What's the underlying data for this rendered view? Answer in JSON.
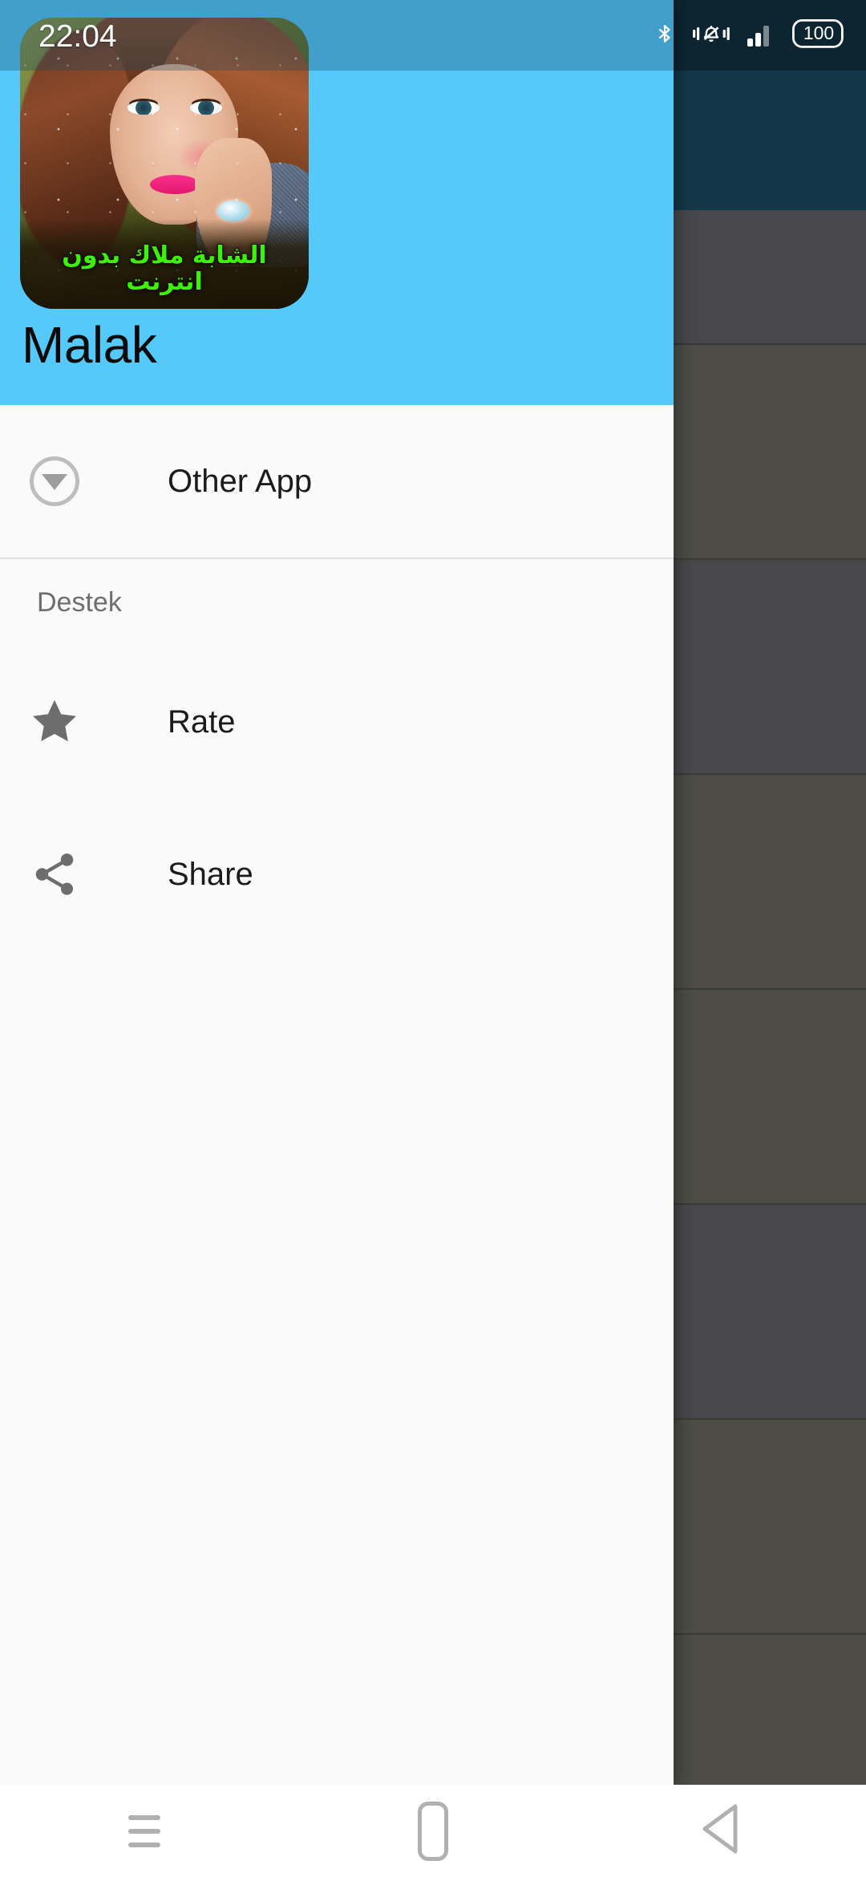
{
  "status_bar": {
    "time": "22:04",
    "icons": [
      {
        "name": "bluetooth-icon",
        "label": "Bluetooth"
      },
      {
        "name": "ringer-vibrate-off-icon",
        "label": "Silent / vibrate"
      },
      {
        "name": "signal-bars-icon",
        "label": "Cellular signal"
      },
      {
        "name": "battery-icon",
        "label": "Battery"
      }
    ],
    "battery_level": "100",
    "left_background": "#3e92b8",
    "right_background": "#5e2424"
  },
  "drawer": {
    "header": {
      "app_title": "Malak",
      "app_icon_caption": "الشابة ملاك بدون انترنت",
      "background_color": "#55c9fa",
      "title_color": "#0a0a0a"
    },
    "items": [
      {
        "id": "other-app",
        "label": "Other App",
        "icon": "arrow-drop-down-circle-icon"
      }
    ],
    "sections": [
      {
        "id": "destek",
        "title": "Destek",
        "items": [
          {
            "id": "rate",
            "label": "Rate",
            "icon": "star-icon"
          },
          {
            "id": "share",
            "label": "Share",
            "icon": "share-icon"
          }
        ]
      }
    ],
    "background_color": "#fafafa"
  },
  "background_app": {
    "toolbar_color": "#1d5068",
    "list_color": "#6f6f66",
    "scrim_opacity": "0.30"
  },
  "navigation_bar": {
    "buttons": [
      {
        "id": "recents",
        "icon": "recents-icon",
        "label": "Recents"
      },
      {
        "id": "home",
        "icon": "home-icon",
        "label": "Home"
      },
      {
        "id": "back",
        "icon": "back-icon",
        "label": "Back"
      }
    ],
    "background_color": "#ffffff"
  }
}
